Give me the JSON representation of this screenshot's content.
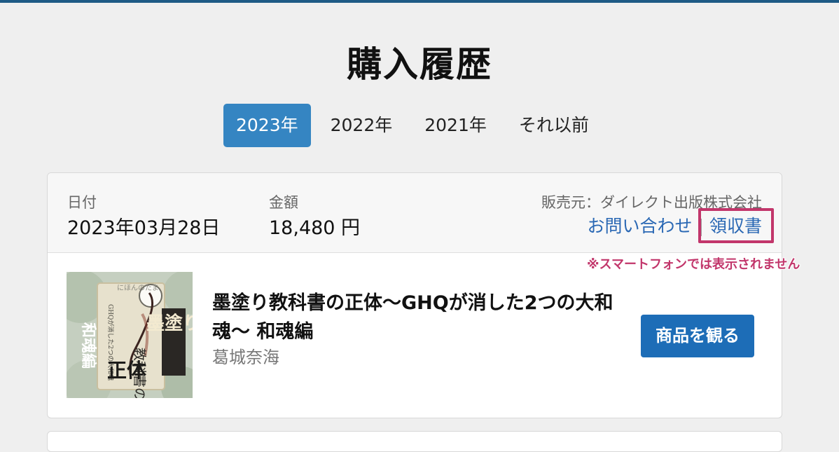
{
  "page": {
    "title": "購入履歴"
  },
  "tabs": [
    {
      "label": "2023年",
      "active": true
    },
    {
      "label": "2022年",
      "active": false
    },
    {
      "label": "2021年",
      "active": false
    },
    {
      "label": "それ以前",
      "active": false
    }
  ],
  "order": {
    "date_label": "日付",
    "date_value": "2023年03月28日",
    "amount_label": "金額",
    "amount_value": "18,480 円",
    "seller": "販売元：ダイレクト出版株式会社",
    "contact_link": "お問い合わせ",
    "separator": "|",
    "receipt_link": "領収書",
    "note": "※スマートフォンでは表示されません",
    "product": {
      "title": "墨塗り教科書の正体〜GHQが消した2つの大和魂〜 和魂編",
      "author": "葛城奈海",
      "view_button": "商品を観る",
      "cover_text": {
        "main": "墨塗り",
        "sub": "教科書の",
        "big": "正体",
        "side": "和魂編",
        "small": "GHQが消した2つの大和魂",
        "tiny": "にほんのたま"
      }
    }
  },
  "colors": {
    "accent": "#3585c2",
    "button": "#1d6db7",
    "link": "#2a68b4",
    "highlight": "#c2366b",
    "topbar": "#1e5a85"
  }
}
